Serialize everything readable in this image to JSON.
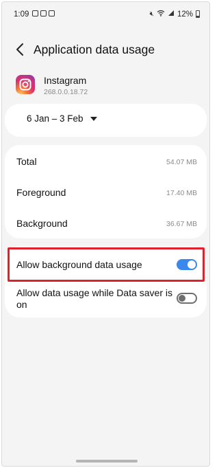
{
  "status_bar": {
    "time": "1:09",
    "battery": "12%"
  },
  "header": {
    "title": "Application data usage",
    "back_icon": "chevron-left-icon"
  },
  "app": {
    "name": "Instagram",
    "version": "268.0.0.18.72",
    "icon": "instagram-icon"
  },
  "date_range": {
    "label": "6 Jan – 3 Feb",
    "icon": "dropdown-caret-icon"
  },
  "usage": {
    "rows": [
      {
        "label": "Total",
        "value": "54.07 MB"
      },
      {
        "label": "Foreground",
        "value": "17.40 MB"
      },
      {
        "label": "Background",
        "value": "36.67 MB"
      }
    ]
  },
  "settings": {
    "allow_background": {
      "label": "Allow background data usage",
      "enabled": true
    },
    "allow_data_saver": {
      "label": "Allow data usage while Data saver is on",
      "enabled": false
    }
  },
  "colors": {
    "accent": "#3a88ee",
    "highlight_box": "#e0202a",
    "background": "#f4f4f5"
  }
}
